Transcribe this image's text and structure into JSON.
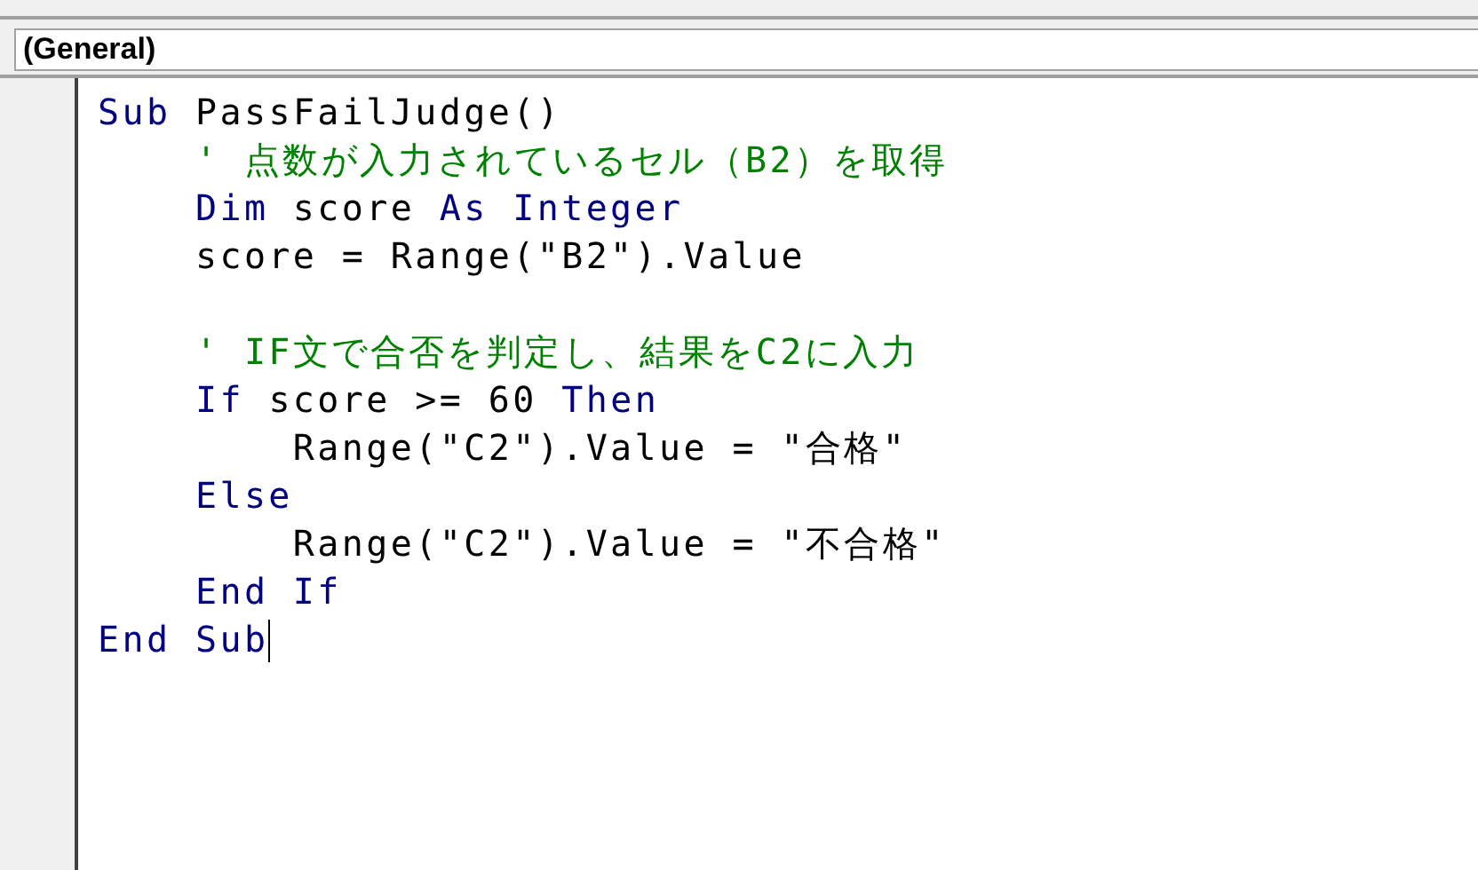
{
  "object_box": {
    "value": "(General)"
  },
  "code_lines": [
    {
      "kind": "code",
      "cursor": false,
      "tokens": [
        {
          "kind": "keyword",
          "text": "Sub"
        },
        {
          "kind": "plain",
          "text": " PassFailJudge()"
        }
      ]
    },
    {
      "kind": "code",
      "cursor": false,
      "tokens": [
        {
          "kind": "comment",
          "text": "    ' 点数が入力されているセル（B2）を取得"
        }
      ]
    },
    {
      "kind": "code",
      "cursor": false,
      "tokens": [
        {
          "kind": "keyword",
          "text": "    Dim"
        },
        {
          "kind": "plain",
          "text": " score "
        },
        {
          "kind": "keyword",
          "text": "As Integer"
        }
      ]
    },
    {
      "kind": "code",
      "cursor": false,
      "tokens": [
        {
          "kind": "plain",
          "text": "    score = Range(\"B2\").Value"
        }
      ]
    },
    {
      "kind": "blank"
    },
    {
      "kind": "code",
      "cursor": false,
      "tokens": [
        {
          "kind": "comment",
          "text": "    ' IF文で合否を判定し、結果をC2に入力"
        }
      ]
    },
    {
      "kind": "code",
      "cursor": false,
      "tokens": [
        {
          "kind": "keyword",
          "text": "    If"
        },
        {
          "kind": "plain",
          "text": " score >= 60 "
        },
        {
          "kind": "keyword",
          "text": "Then"
        }
      ]
    },
    {
      "kind": "code",
      "cursor": false,
      "tokens": [
        {
          "kind": "plain",
          "text": "        Range(\"C2\").Value = \"合格\""
        }
      ]
    },
    {
      "kind": "code",
      "cursor": false,
      "tokens": [
        {
          "kind": "keyword",
          "text": "    Else"
        }
      ]
    },
    {
      "kind": "code",
      "cursor": false,
      "tokens": [
        {
          "kind": "plain",
          "text": "        Range(\"C2\").Value = \"不合格\""
        }
      ]
    },
    {
      "kind": "code",
      "cursor": false,
      "tokens": [
        {
          "kind": "keyword",
          "text": "    End If"
        }
      ]
    },
    {
      "kind": "code",
      "cursor": true,
      "tokens": [
        {
          "kind": "keyword",
          "text": "End Sub"
        }
      ]
    }
  ]
}
